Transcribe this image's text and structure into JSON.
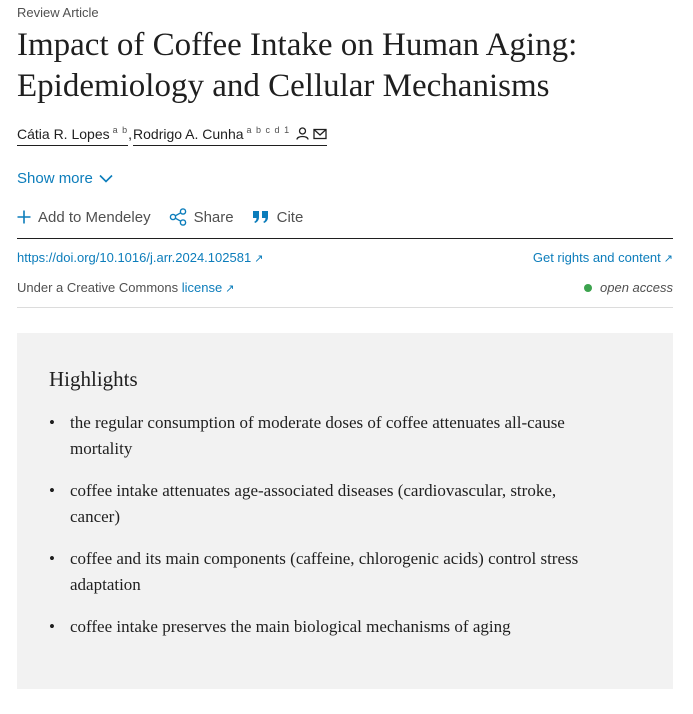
{
  "article": {
    "type": "Review Article",
    "title": "Impact of Coffee Intake on Human Aging: Epidemiology and Cellular Mechanisms",
    "authors": [
      {
        "name": "Cátia R. Lopes",
        "affiliations": "a b"
      },
      {
        "name": "Rodrigo A. Cunha",
        "affiliations": "a b c d 1"
      }
    ],
    "author_separator": ",",
    "show_more": "Show more",
    "doi": "https://doi.org/10.1016/j.arr.2024.102581",
    "rights": "Get rights and content",
    "license_prefix": "Under a Creative Commons",
    "license_link": "license",
    "access": "open access"
  },
  "actions": {
    "mendeley": "Add to Mendeley",
    "share": "Share",
    "cite": "Cite"
  },
  "icons": {
    "external_link": "↗"
  },
  "highlights": {
    "title": "Highlights",
    "items": [
      "the regular consumption of moderate doses of coffee attenuates all-cause mortality",
      "coffee intake attenuates age-associated diseases (cardiovascular, stroke, cancer)",
      "coffee and its main components (caffeine, chlorogenic acids) control stress adaptation",
      "coffee intake preserves the main biological mechanisms of aging"
    ]
  },
  "colors": {
    "link": "#0c7dbb",
    "text": "#1f1f1f",
    "muted": "#505050",
    "highlight_bg": "#f2f2f2",
    "open_access_dot": "#3ca34e"
  }
}
